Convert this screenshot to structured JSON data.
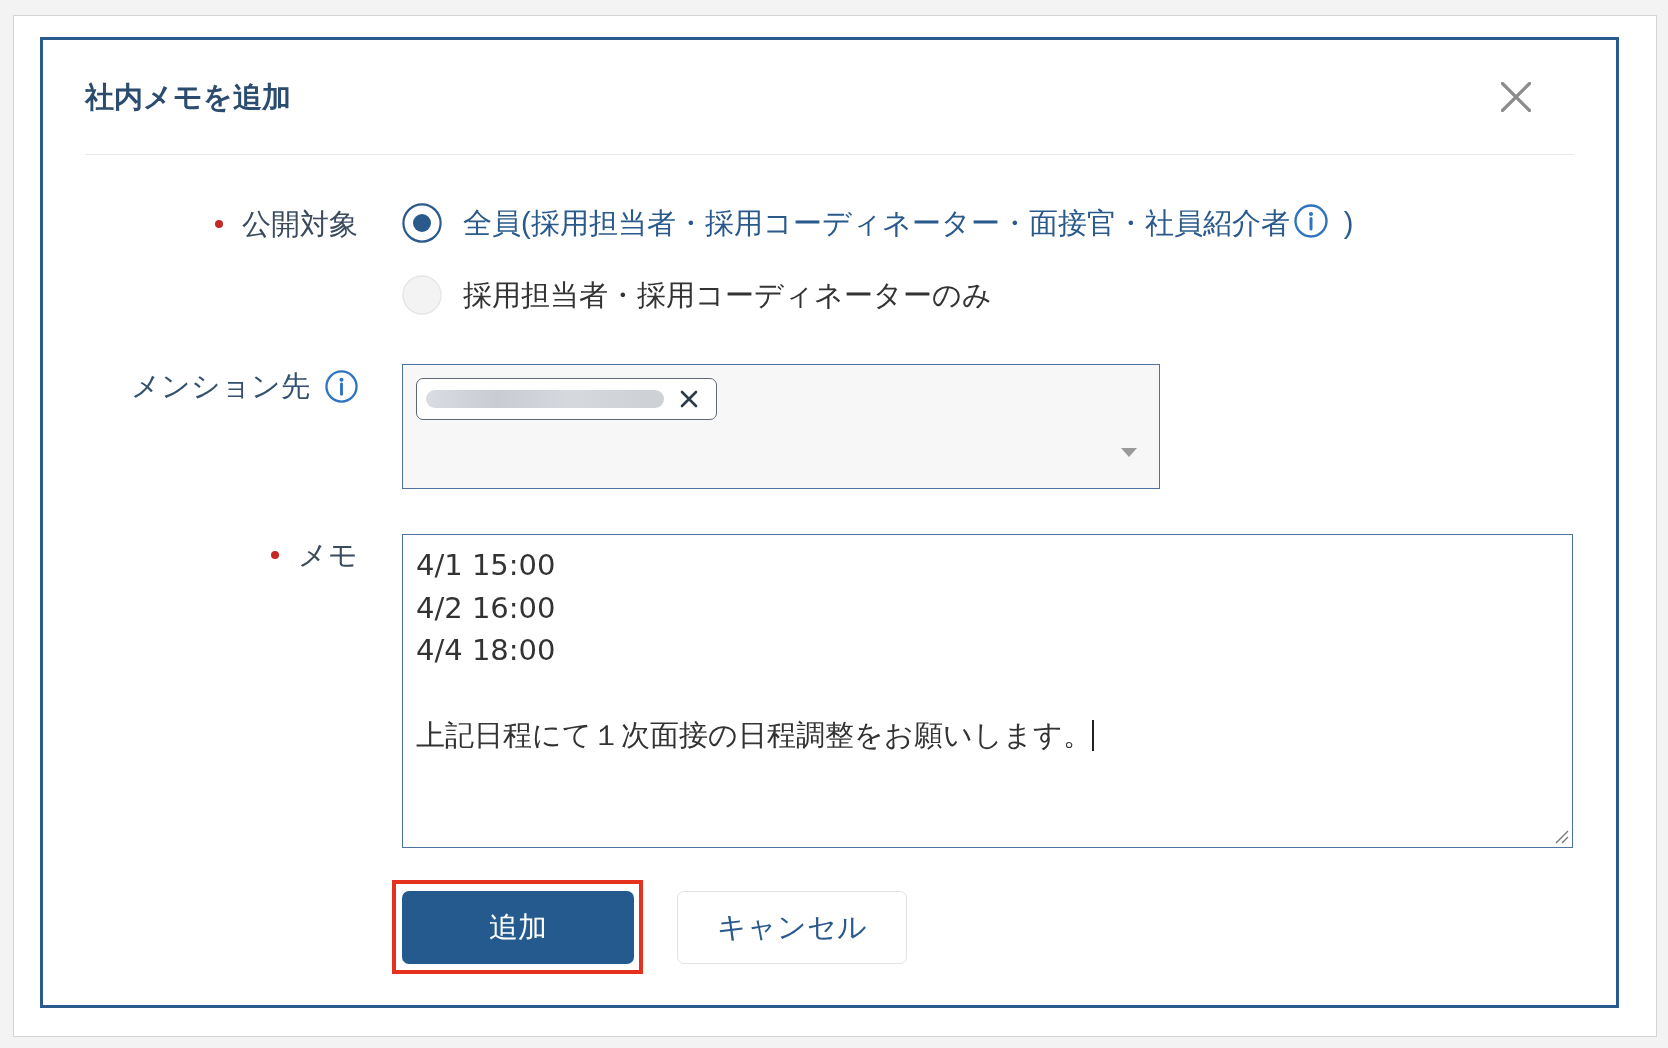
{
  "dialog": {
    "title": "社内メモを追加"
  },
  "fields": [
    {
      "kind": "radio_group",
      "label": "公開対象",
      "required": true,
      "info": false,
      "options": [
        {
          "label": "全員(採用担当者・採用コーディネーター・面接官・社員紹介者",
          "info": true,
          "suffix": ")",
          "selected": true
        },
        {
          "label": "採用担当者・採用コーディネーターのみ",
          "info": false,
          "selected": false
        }
      ]
    },
    {
      "kind": "multi_select",
      "label": "メンション先",
      "required": false,
      "info": true,
      "chips": [
        {
          "blurred": true,
          "removable": true
        }
      ]
    },
    {
      "kind": "textarea",
      "label": "メモ",
      "required": true,
      "info": false,
      "focused": true,
      "value": "4/1 15:00\n4/2 16:00\n4/4 18:00\n\n上記日程にて１次面接の日程調整をお願いします。"
    }
  ],
  "buttons": [
    {
      "label": "追加",
      "kind": "primary",
      "highlighted": true
    },
    {
      "label": "キャンセル",
      "kind": "secondary",
      "highlighted": false
    }
  ]
}
